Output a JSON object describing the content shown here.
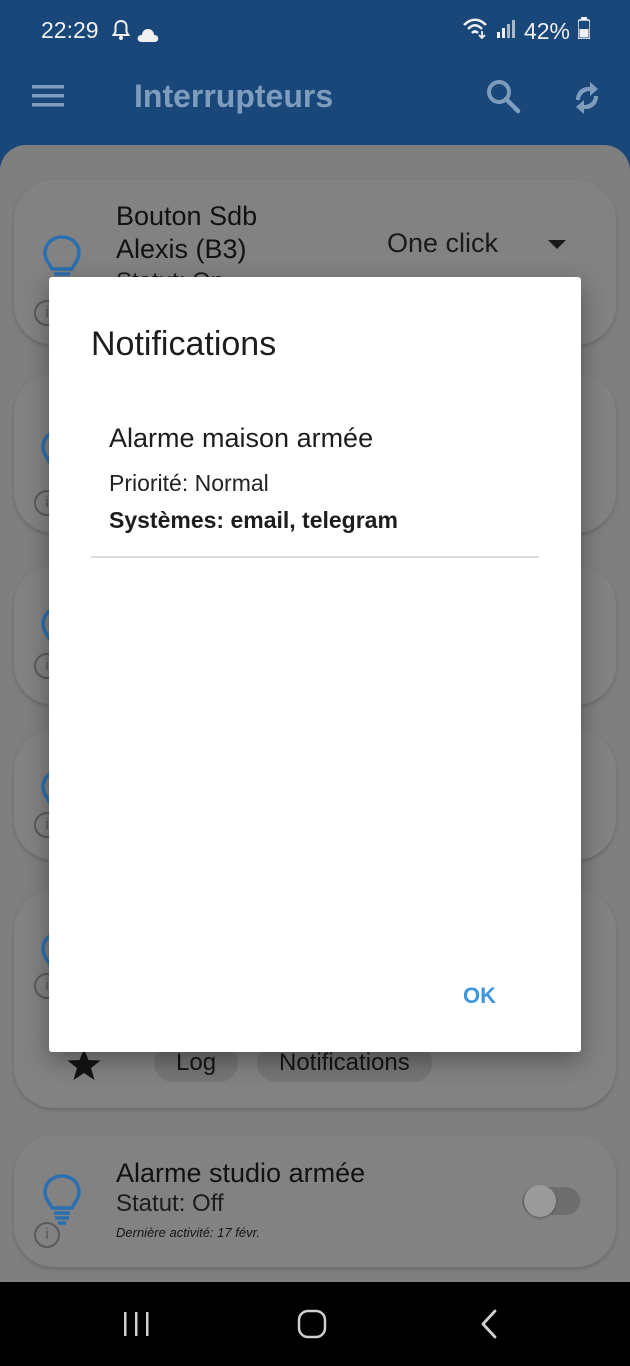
{
  "status_bar": {
    "time": "22:29",
    "battery": "42%",
    "icons": [
      "bell-icon",
      "cloud-icon",
      "wifi-icon",
      "signal-icon",
      "battery-icon"
    ]
  },
  "app_bar": {
    "title": "Interrupteurs",
    "icons": [
      "menu-icon",
      "search-icon",
      "sync-icon"
    ]
  },
  "background_cards": [
    {
      "title_line1": "Bouton Sdb",
      "title_line2": "Alexis (B3)",
      "status": "Statut: On",
      "select_value": "One click"
    },
    {
      "chips": [
        "Log",
        "Notifications"
      ]
    },
    {
      "title": "Alarme studio armée",
      "status": "Statut: Off",
      "activity": "Dernière activité: 17 févr.",
      "toggle_on": false
    }
  ],
  "dialog": {
    "title": "Notifications",
    "notification": {
      "name": "Alarme maison armée",
      "priority": "Priorité: Normal",
      "systems": "Systèmes: email, telegram"
    },
    "ok_label": "OK"
  },
  "colors": {
    "status_bar_bg": "#19477a",
    "accent": "#3e97dc",
    "bulb_blue": "#2a6fb0"
  }
}
